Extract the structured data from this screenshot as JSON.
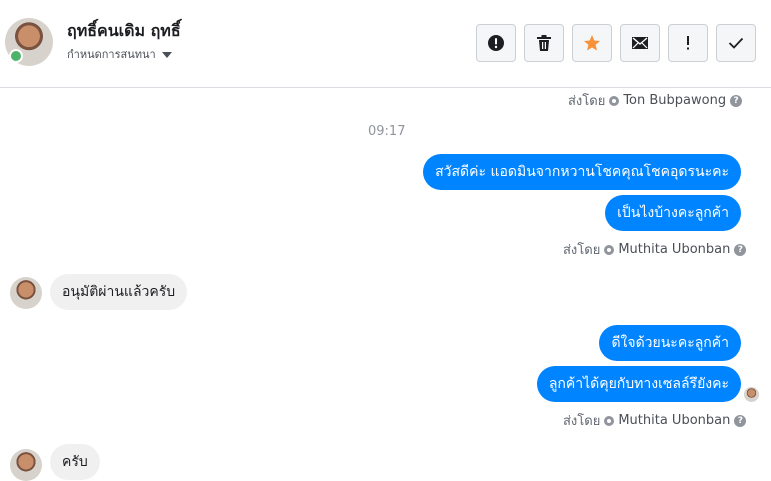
{
  "header": {
    "name": "ฤทธิ์คนเดิม ฤทธิ์",
    "subtitle": "กำหนดการสนทนา",
    "toolbar": [
      {
        "name": "report-button",
        "icon": "exclamation-circle-icon"
      },
      {
        "name": "delete-button",
        "icon": "trash-icon"
      },
      {
        "name": "star-button",
        "icon": "star-icon"
      },
      {
        "name": "mail-button",
        "icon": "envelope-icon"
      },
      {
        "name": "mark-button",
        "icon": "exclamation-icon"
      },
      {
        "name": "done-button",
        "icon": "checkmark-icon"
      }
    ]
  },
  "thread": {
    "sent_by_prefix": "ส่งโดย",
    "top_meta_agent": "Ton Bubpawong",
    "time_label": "09:17",
    "outgoing_1": "สวัสดีค่ะ แอดมินจากหวานโชคคุณโชคอุดรนะคะ",
    "outgoing_2": "เป็นไงบ้างคะลูกค้า",
    "meta_agent_1": "Muthita Ubonban",
    "incoming_1": "อนุมัติผ่านแล้วครับ",
    "outgoing_3": "ดีใจด้วยนะคะลูกค้า",
    "outgoing_4": "ลูกค้าได้คุยกับทางเซลล์รึยังคะ",
    "meta_agent_2": "Muthita Ubonban",
    "incoming_2": "ครับ",
    "help_glyph": "?"
  },
  "colors": {
    "outgoing_bubble": "#0084ff",
    "incoming_bubble": "#f1f0f0",
    "star": "#f7923b",
    "online": "#4db36a"
  }
}
